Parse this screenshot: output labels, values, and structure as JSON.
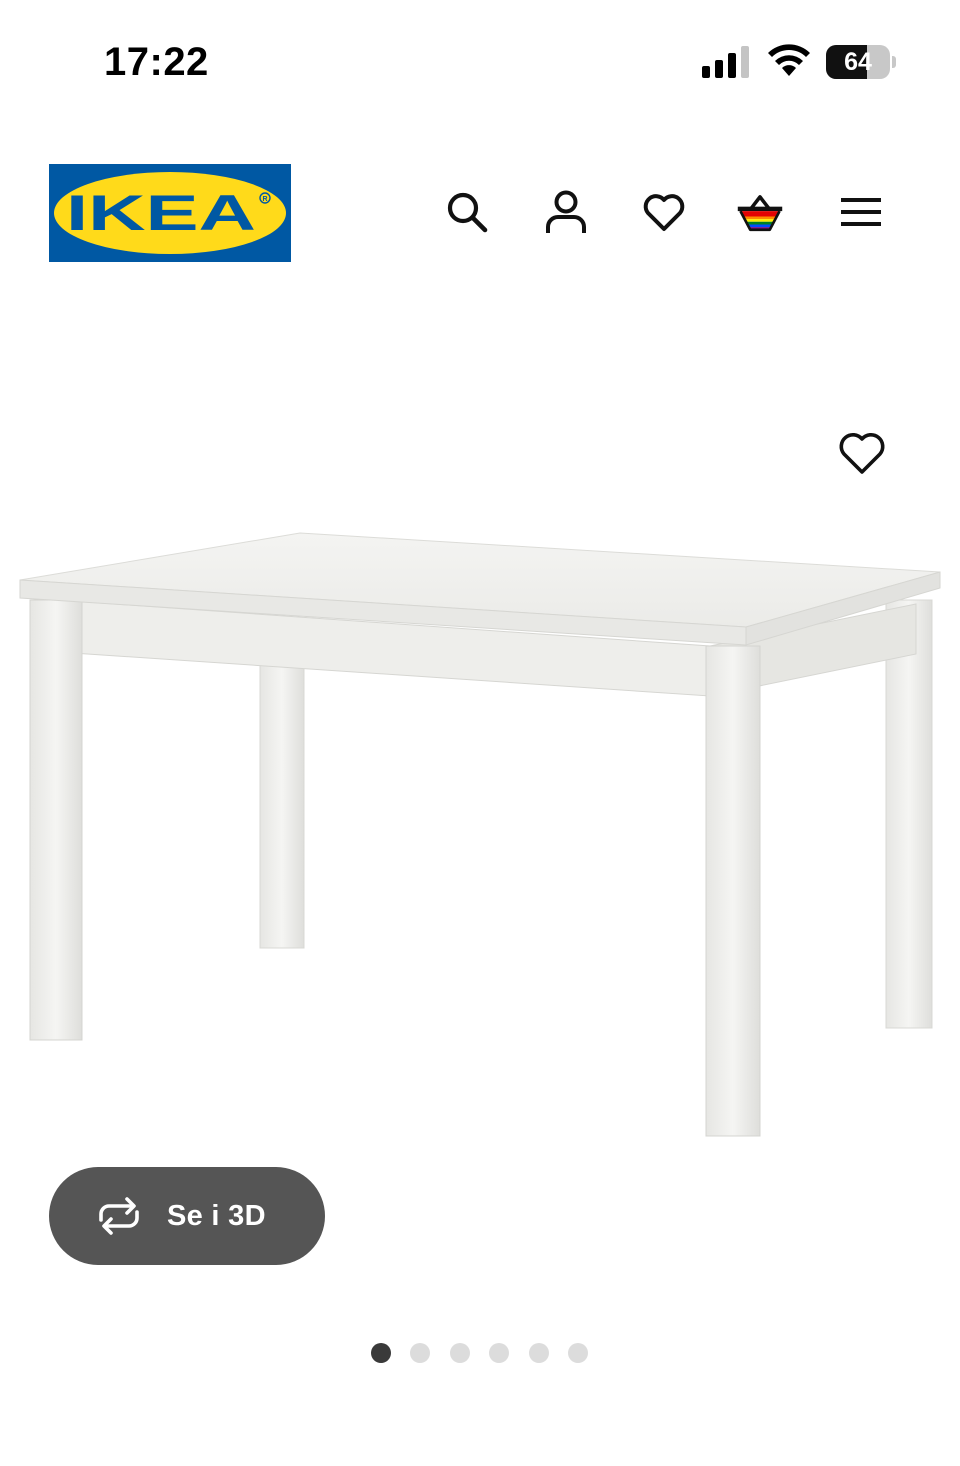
{
  "status_bar": {
    "time": "17:22",
    "battery_level": "64",
    "battery_percent": 64,
    "icons": [
      "signal-icon",
      "wifi-icon",
      "battery-icon"
    ]
  },
  "header": {
    "logo_text": "IKEA",
    "logo_colors": {
      "background": "#0058a3",
      "oval": "#ffda1a",
      "text": "#0058a3"
    },
    "icons": [
      "search-icon",
      "account-icon",
      "heart-icon",
      "basket-icon",
      "menu-icon"
    ]
  },
  "product": {
    "favorite_icon": "heart-icon",
    "view_3d_label": "Se i 3D",
    "view_3d_icon": "rotate-icon",
    "gallery": {
      "total_images": 6,
      "active_index": 0
    }
  },
  "colors": {
    "button_bg": "#555555",
    "dot_active": "#3a3a3a",
    "dot_inactive": "#dcdcdc"
  }
}
